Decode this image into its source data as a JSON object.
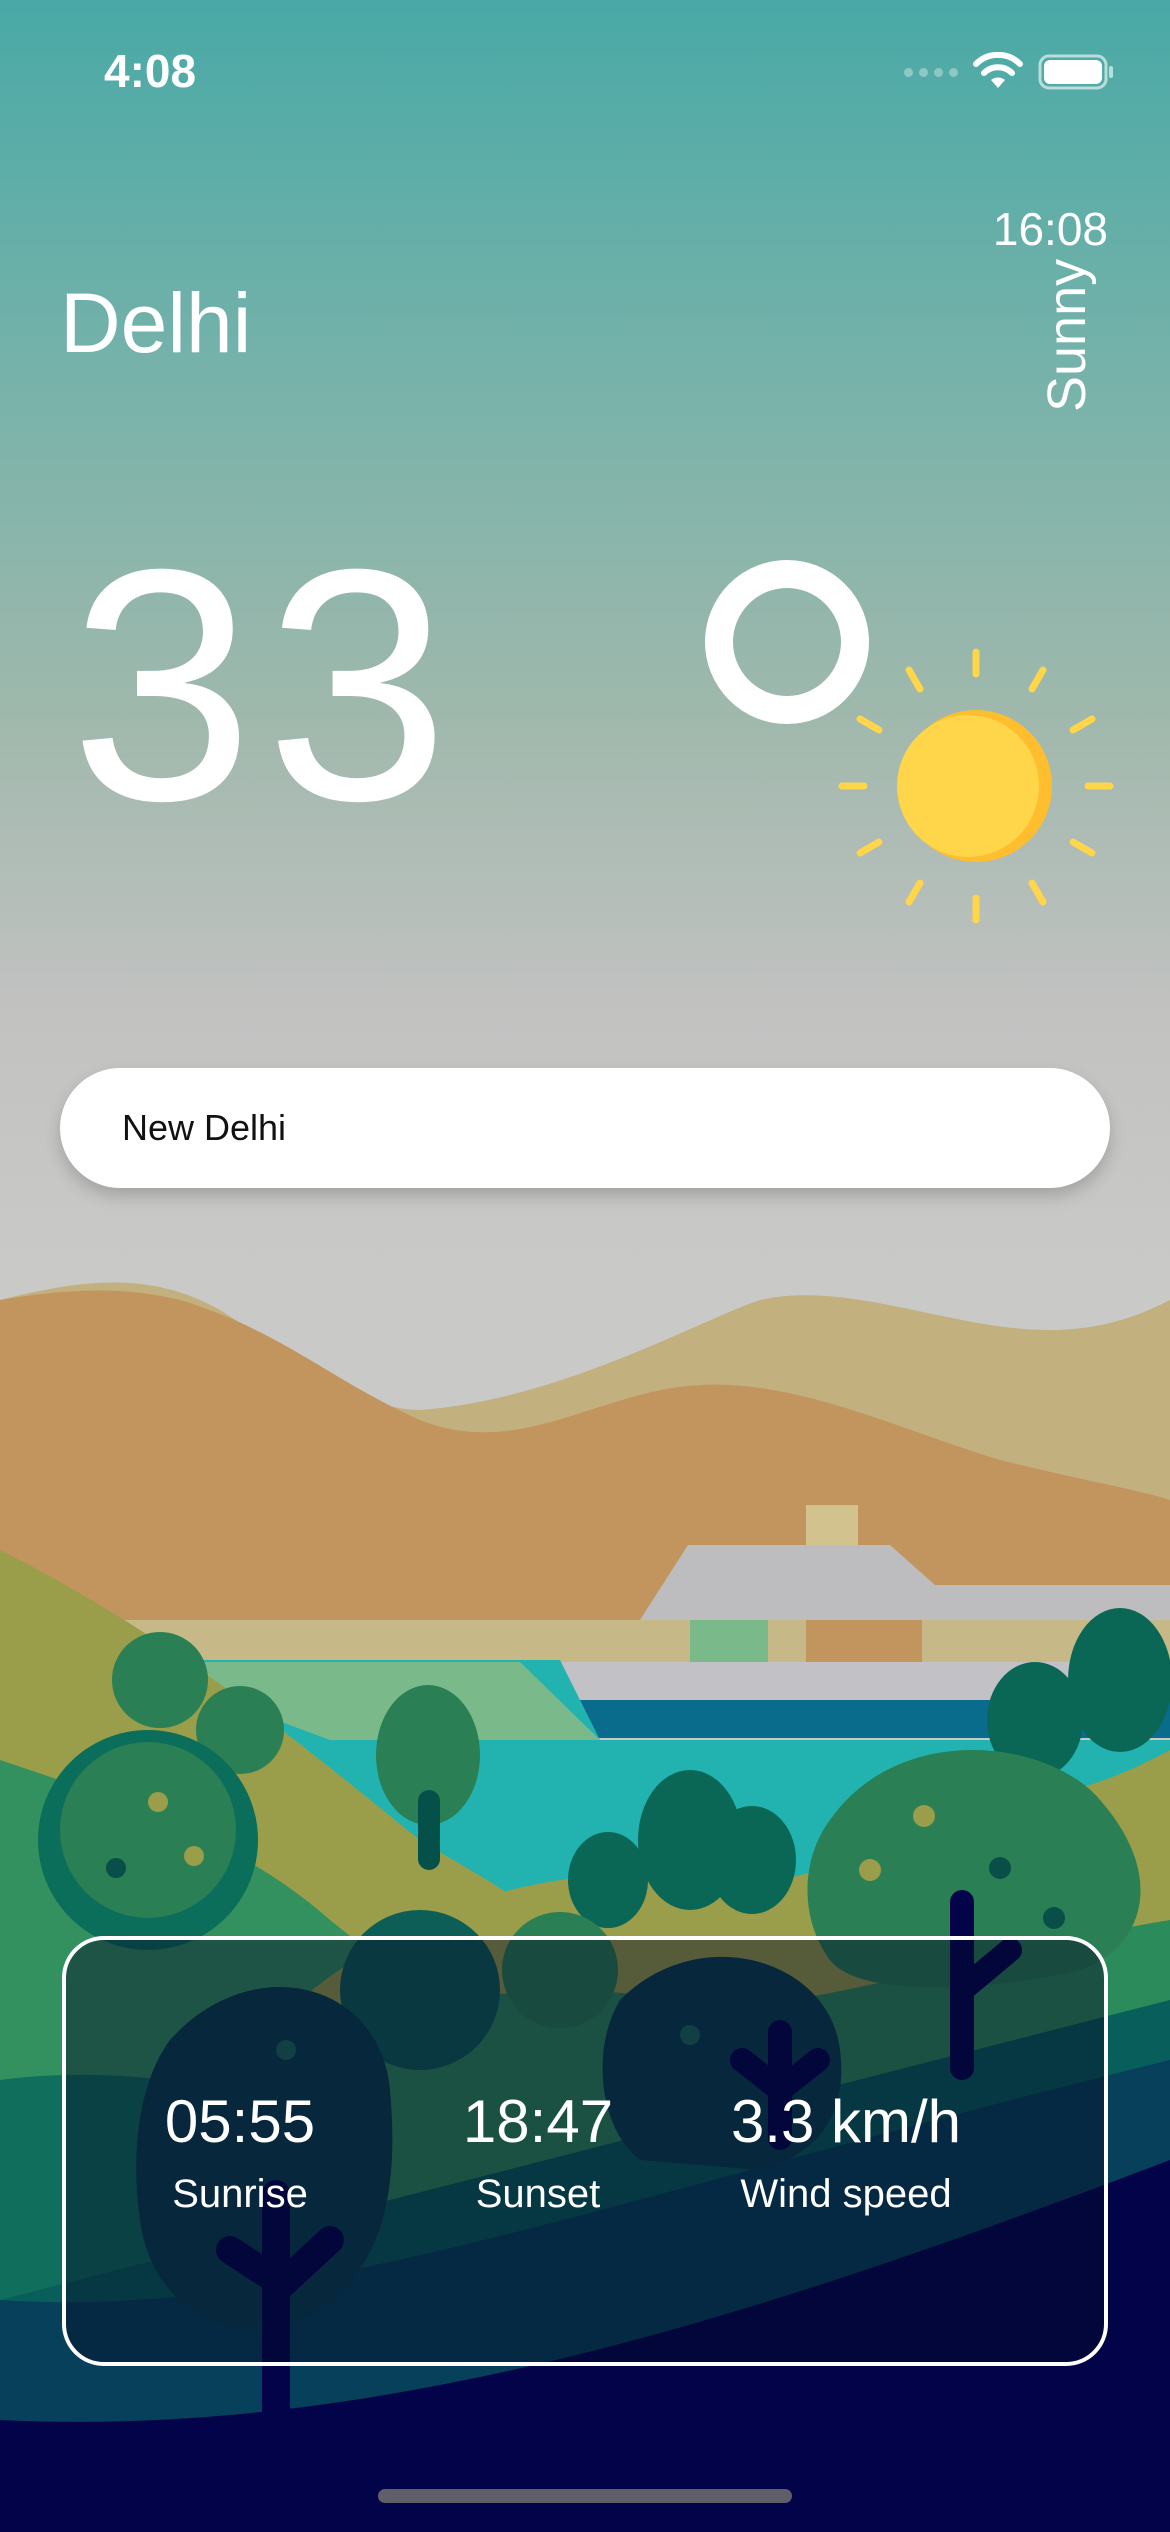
{
  "status_bar": {
    "time": "4:08"
  },
  "weather": {
    "local_time": "16:08",
    "condition": "Sunny",
    "city": "Delhi",
    "temperature": "33",
    "condition_icon": "sun-icon"
  },
  "search": {
    "value": "New Delhi"
  },
  "stats": [
    {
      "value": "05:55",
      "label": "Sunrise"
    },
    {
      "value": "18:47",
      "label": "Sunset"
    },
    {
      "value": "3.3 km/h",
      "label": "Wind speed"
    }
  ],
  "colors": {
    "sun": "#ffd54a",
    "card_border": "#ffffff",
    "text": "#ffffff"
  }
}
